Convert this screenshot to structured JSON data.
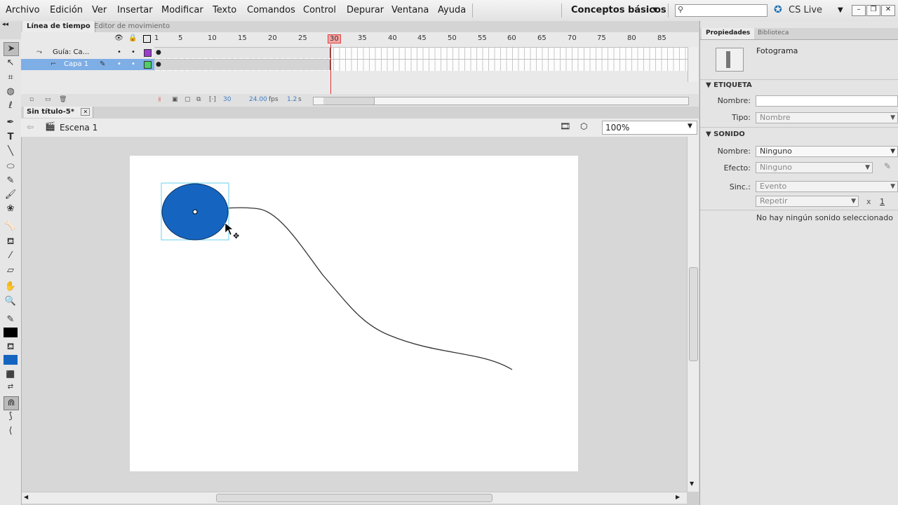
{
  "menu": [
    "Archivo",
    "Edición",
    "Ver",
    "Insertar",
    "Modificar",
    "Texto",
    "Comandos",
    "Control",
    "Depurar",
    "Ventana",
    "Ayuda"
  ],
  "workspace": "Conceptos básicos",
  "cs_live": "CS Live",
  "search_placeholder": "",
  "timeline": {
    "tabs": [
      "Línea de tiempo",
      "Editor de movimiento"
    ],
    "frame_numbers": [
      "1",
      "5",
      "10",
      "15",
      "20",
      "25",
      "30",
      "35",
      "40",
      "45",
      "50",
      "55",
      "60",
      "65",
      "70",
      "75",
      "80",
      "85"
    ],
    "layers": [
      "Guía: Ca...",
      "Capa 1"
    ],
    "current_frame": "30",
    "fps": "24.00",
    "fps_unit": "fps",
    "time": "1.2",
    "time_unit": "s"
  },
  "document": {
    "tab": "Sin título-5*",
    "scene": "Escena 1",
    "zoom": "100%"
  },
  "properties": {
    "tabs": [
      "Propiedades",
      "Biblioteca"
    ],
    "type": "Fotograma",
    "label_section": "ETIQUETA",
    "nombre_label": "Nombre:",
    "nombre_value": "",
    "tipo_label": "Tipo:",
    "tipo_value": "Nombre",
    "sound_section": "SONIDO",
    "sound_nombre_label": "Nombre:",
    "sound_nombre_value": "Ninguno",
    "efecto_label": "Efecto:",
    "efecto_value": "Ninguno",
    "sinc_label": "Sinc.:",
    "sinc_value": "Evento",
    "repeat_value": "Repetir",
    "repeat_count_x": "x",
    "repeat_count": "1",
    "no_sound": "No hay ningún sonido seleccionado"
  },
  "colors": {
    "fill": "#1565c0",
    "selection": "#6ad0ec",
    "layer_selected": "#7eaee6"
  }
}
